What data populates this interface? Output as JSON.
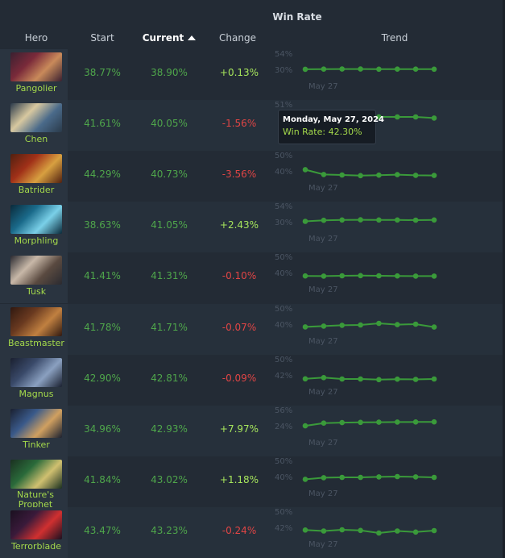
{
  "header": {
    "group_title": "Win Rate",
    "columns": {
      "hero": "Hero",
      "start": "Start",
      "current": "Current",
      "change": "Change",
      "trend": "Trend"
    }
  },
  "tooltip": {
    "date": "Monday, May 27, 2024",
    "win_rate": "Win Rate: 42.30%"
  },
  "colors": {
    "hero_name": "#a4d94b",
    "value_green": "#4fa64b",
    "change_pos": "#a6e55c",
    "change_neg": "#e04545",
    "spark": "#3a9a3a"
  },
  "rows": [
    {
      "hero": "Pangolier",
      "start": "38.77%",
      "current": "38.90%",
      "change": "+0.13%",
      "dir": "pos",
      "y_top": "54%",
      "y_bottom": "30%",
      "x_label": "May 27",
      "trend": [
        38.5,
        38.8,
        38.9,
        38.9,
        38.7,
        38.8,
        38.8,
        38.6
      ]
    },
    {
      "hero": "Chen",
      "start": "41.61%",
      "current": "40.05%",
      "change": "-1.56%",
      "dir": "neg",
      "y_top": "51%",
      "y_bottom": "",
      "x_label": "",
      "trend": [
        41.6,
        41.5,
        41.6,
        41.6,
        41.7,
        41.6,
        41.5,
        40.1
      ]
    },
    {
      "hero": "Batrider",
      "start": "44.29%",
      "current": "40.73%",
      "change": "-3.56%",
      "dir": "neg",
      "y_top": "50%",
      "y_bottom": "40%",
      "x_label": "May 27",
      "trend": [
        44.3,
        41.3,
        41.0,
        40.6,
        40.9,
        41.2,
        40.8,
        40.7
      ]
    },
    {
      "hero": "Morphling",
      "start": "38.63%",
      "current": "41.05%",
      "change": "+2.43%",
      "dir": "pos",
      "y_top": "54%",
      "y_bottom": "30%",
      "x_label": "May 27",
      "trend": [
        39.0,
        40.6,
        41.1,
        41.3,
        41.1,
        41.1,
        40.8,
        41.0
      ]
    },
    {
      "hero": "Tusk",
      "start": "41.41%",
      "current": "41.31%",
      "change": "-0.10%",
      "dir": "neg",
      "y_top": "50%",
      "y_bottom": "40%",
      "x_label": "May 27",
      "trend": [
        41.4,
        41.3,
        41.5,
        41.6,
        41.5,
        41.4,
        41.3,
        41.3
      ]
    },
    {
      "hero": "Beastmaster",
      "start": "41.78%",
      "current": "41.71%",
      "change": "-0.07%",
      "dir": "neg",
      "y_top": "50%",
      "y_bottom": "40%",
      "x_label": "May 27",
      "trend": [
        41.8,
        42.3,
        42.8,
        43.0,
        44.0,
        43.2,
        43.5,
        41.7
      ]
    },
    {
      "hero": "Magnus",
      "start": "42.90%",
      "current": "42.81%",
      "change": "-0.09%",
      "dir": "neg",
      "y_top": "50%",
      "y_bottom": "42%",
      "x_label": "May 27",
      "trend": [
        42.9,
        43.5,
        42.8,
        42.8,
        42.5,
        42.7,
        42.6,
        42.8
      ]
    },
    {
      "hero": "Tinker",
      "start": "34.96%",
      "current": "42.93%",
      "change": "+7.97%",
      "dir": "pos",
      "y_top": "56%",
      "y_bottom": "24%",
      "x_label": "May 27",
      "trend": [
        35.0,
        40.5,
        41.5,
        42.0,
        42.3,
        42.5,
        42.7,
        42.9
      ]
    },
    {
      "hero": "Nature's Prophet",
      "start": "41.84%",
      "current": "43.02%",
      "change": "+1.18%",
      "dir": "pos",
      "y_top": "50%",
      "y_bottom": "40%",
      "x_label": "May 27",
      "trend": [
        41.8,
        42.8,
        43.0,
        43.0,
        43.3,
        43.5,
        43.3,
        43.0
      ]
    },
    {
      "hero": "Terrorblade",
      "start": "43.47%",
      "current": "43.23%",
      "change": "-0.24%",
      "dir": "neg",
      "y_top": "50%",
      "y_bottom": "42%",
      "x_label": "May 27",
      "trend": [
        43.5,
        43.0,
        43.6,
        43.3,
        42.0,
        43.0,
        42.5,
        43.2
      ]
    }
  ]
}
